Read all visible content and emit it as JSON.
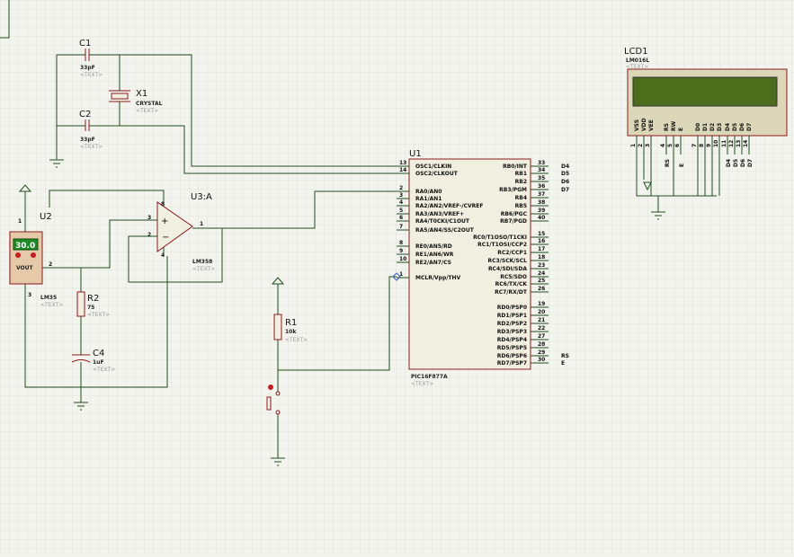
{
  "components": {
    "c1": {
      "ref": "C1",
      "value": "33pF",
      "text": "<TEXT>"
    },
    "c2": {
      "ref": "C2",
      "value": "33pF",
      "text": "<TEXT>"
    },
    "x1": {
      "ref": "X1",
      "value": "CRYSTAL",
      "text": "<TEXT>"
    },
    "u1": {
      "ref": "U1",
      "part": "PIC16F877A",
      "text": "<TEXT>",
      "left_pins": [
        {
          "num": "13",
          "name": "OSC1/CLKIN"
        },
        {
          "num": "14",
          "name": "OSC2/CLKOUT"
        },
        {
          "num": "2",
          "name": "RA0/AN0"
        },
        {
          "num": "3",
          "name": "RA1/AN1"
        },
        {
          "num": "4",
          "name": "RA2/AN2/VREF-/CVREF"
        },
        {
          "num": "5",
          "name": "RA3/AN3/VREF+"
        },
        {
          "num": "6",
          "name": "RA4/T0CKI/C1OUT"
        },
        {
          "num": "7",
          "name": "RA5/AN4/SS/C2OUT"
        },
        {
          "num": "8",
          "name": "RE0/AN5/RD"
        },
        {
          "num": "9",
          "name": "RE1/AN6/WR"
        },
        {
          "num": "10",
          "name": "RE2/AN7/CS"
        },
        {
          "num": "1",
          "name": "MCLR/Vpp/THV"
        }
      ],
      "right_pins": [
        {
          "num": "33",
          "name": "RB0/INT",
          "net": "D4"
        },
        {
          "num": "34",
          "name": "RB1",
          "net": "D5"
        },
        {
          "num": "35",
          "name": "RB2",
          "net": "D6"
        },
        {
          "num": "36",
          "name": "RB3/PGM",
          "net": "D7"
        },
        {
          "num": "37",
          "name": "RB4",
          "net": ""
        },
        {
          "num": "38",
          "name": "RB5",
          "net": ""
        },
        {
          "num": "39",
          "name": "RB6/PGC",
          "net": ""
        },
        {
          "num": "40",
          "name": "RB7/PGD",
          "net": ""
        },
        {
          "num": "15",
          "name": "RC0/T1OSO/T1CKI",
          "net": ""
        },
        {
          "num": "16",
          "name": "RC1/T1OSI/CCP2",
          "net": ""
        },
        {
          "num": "17",
          "name": "RC2/CCP1",
          "net": ""
        },
        {
          "num": "18",
          "name": "RC3/SCK/SCL",
          "net": ""
        },
        {
          "num": "23",
          "name": "RC4/SDI/SDA",
          "net": ""
        },
        {
          "num": "24",
          "name": "RC5/SDO",
          "net": ""
        },
        {
          "num": "25",
          "name": "RC6/TX/CK",
          "net": ""
        },
        {
          "num": "26",
          "name": "RC7/RX/DT",
          "net": ""
        },
        {
          "num": "19",
          "name": "RD0/PSP0",
          "net": ""
        },
        {
          "num": "20",
          "name": "RD1/PSP1",
          "net": ""
        },
        {
          "num": "21",
          "name": "RD2/PSP2",
          "net": ""
        },
        {
          "num": "22",
          "name": "RD3/PSP3",
          "net": ""
        },
        {
          "num": "27",
          "name": "RD4/PSP4",
          "net": ""
        },
        {
          "num": "28",
          "name": "RD5/PSP5",
          "net": ""
        },
        {
          "num": "29",
          "name": "RD6/PSP6",
          "net": "RS"
        },
        {
          "num": "30",
          "name": "RD7/PSP7",
          "net": "E"
        }
      ]
    },
    "u2": {
      "ref": "U2",
      "part": "LM35",
      "text": "<TEXT>",
      "display": "30.0",
      "pin_vout": "VOUT",
      "pins": [
        "1",
        "2",
        "3"
      ]
    },
    "u3": {
      "ref": "U3:A",
      "part": "LM358",
      "text": "<TEXT>",
      "pins": [
        "3",
        "2",
        "1",
        "8",
        "4"
      ]
    },
    "r1": {
      "ref": "R1",
      "value": "10k",
      "text": "<TEXT>"
    },
    "r2": {
      "ref": "R2",
      "value": "75",
      "text": "<TEXT>"
    },
    "c4": {
      "ref": "C4",
      "value": "1uF",
      "text": "<TEXT>"
    },
    "lcd1": {
      "ref": "LCD1",
      "part": "LM016L",
      "text": "<TEXT>",
      "pin_names": [
        "VSS",
        "VDD",
        "VEE",
        "RS",
        "RW",
        "E",
        "D0",
        "D1",
        "D2",
        "D3",
        "D4",
        "D5",
        "D6",
        "D7"
      ],
      "pin_nums": [
        "1",
        "2",
        "3",
        "4",
        "5",
        "6",
        "7",
        "8",
        "9",
        "10",
        "11",
        "12",
        "13",
        "14"
      ],
      "net_labels": [
        "RS",
        "E",
        "D4",
        "D5",
        "D6",
        "D7"
      ]
    }
  },
  "colors": {
    "background": "#f4f4ee",
    "grid": "#d2d2cc",
    "wire": "#1e4d1e",
    "component_outline": "#8b1a1a",
    "chip_fill": "#f0efe0",
    "lcd_screen": "#4c6e1c",
    "lm35_display": "#1f8a26"
  }
}
